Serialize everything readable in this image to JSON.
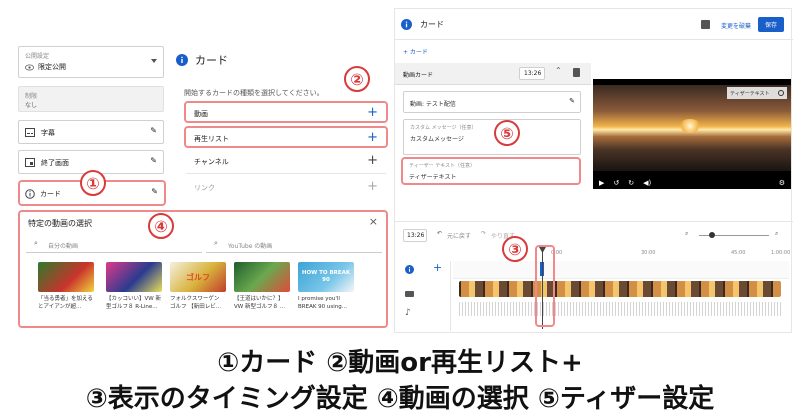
{
  "left_panel": {
    "visibility_label": "公開設定",
    "visibility_value": "限定公開",
    "restriction_label": "制限",
    "restriction_value": "なし",
    "items": [
      {
        "label": "字幕"
      },
      {
        "label": "終了画面"
      },
      {
        "label": "カード"
      }
    ]
  },
  "card_panel": {
    "title": "カード",
    "instruction": "開始するカードの種類を選択してください。",
    "options": [
      {
        "label": "動画"
      },
      {
        "label": "再生リスト"
      },
      {
        "label": "チャンネル"
      },
      {
        "label": "リンク"
      }
    ]
  },
  "select_video": {
    "title": "特定の動画の選択",
    "tab_own": "自分の動画",
    "tab_youtube": "YouTube の動画",
    "videos": [
      {
        "thumb_text": "",
        "caption": "「当る勇者」を加えるとアイアンが超..."
      },
      {
        "thumb_text": "",
        "caption": "【カッコいい】VW 新型ゴルフ８ R-Line..."
      },
      {
        "thumb_text": "ゴルフ",
        "caption": "フォルクスワーゲン ゴルフ 【新田レビ..."
      },
      {
        "thumb_text": "",
        "caption": "【王道はいかに？】VW 新型ゴルフ８ ..."
      },
      {
        "thumb_text": "HOW TO BREAK 90",
        "caption": "I promise you'll BREAK 90 using..."
      }
    ]
  },
  "editor": {
    "title": "カード",
    "discard_label": "変更を破棄",
    "save_label": "保存",
    "add_card_label": "+ カード",
    "video_card_label": "動画カード",
    "video_card_time": "13:26",
    "video_field": "動画: テスト配信",
    "custom_message_label": "カスタム メッセージ（任意）",
    "custom_message_value": "カスタムメッセージ",
    "teaser_label": "ティーザー テキスト（任意）",
    "teaser_value": "ティザーテキスト",
    "player_teaser": "ティザーテキスト"
  },
  "timeline": {
    "time": "13:26",
    "undo_label": "元に戻す",
    "redo_label": "やり直す",
    "ticks": [
      "0:00",
      "30:00",
      "45:00",
      "1:00:00"
    ]
  },
  "annotations": [
    "①",
    "②",
    "③",
    "④",
    "⑤"
  ],
  "captions": {
    "line1": "①カード ②動画or再生リスト+",
    "line2": "③表示のタイミング設定 ④動画の選択 ⑤ティザー設定"
  }
}
